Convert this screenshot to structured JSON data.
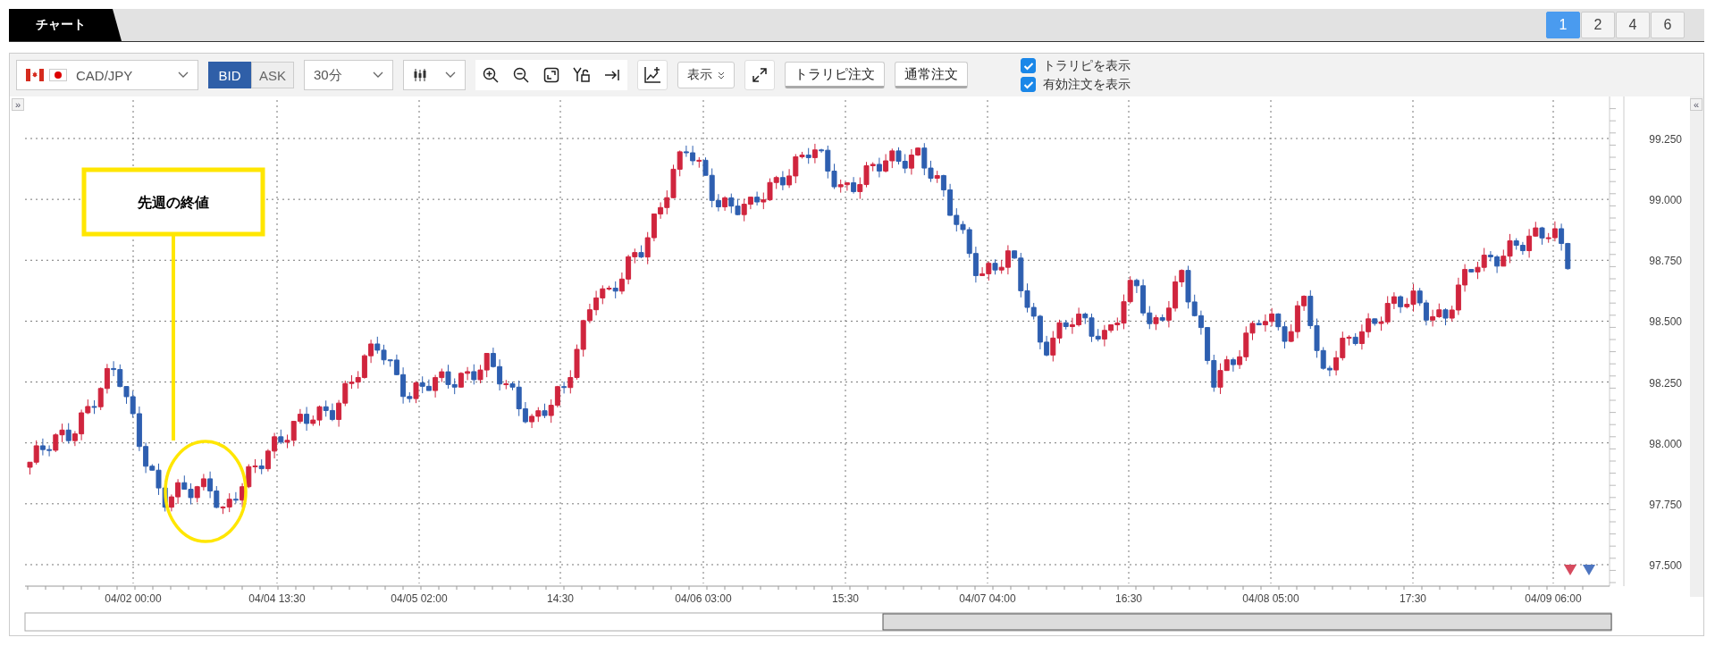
{
  "tabs": [
    {
      "label": "チャート",
      "selected": true
    }
  ],
  "layout_buttons": [
    {
      "label": "1",
      "selected": true
    },
    {
      "label": "2",
      "selected": false
    },
    {
      "label": "4",
      "selected": false
    },
    {
      "label": "6",
      "selected": false
    }
  ],
  "toolbar": {
    "pair": "CAD/JPY",
    "price_type": [
      {
        "label": "BID",
        "selected": true
      },
      {
        "label": "ASK",
        "selected": false
      }
    ],
    "timeframe": "30分",
    "display_button": "表示",
    "order_buttons": [
      "トラリピ注文",
      "通常注文"
    ],
    "checkboxes": [
      {
        "label": "トラリピを表示",
        "checked": true
      },
      {
        "label": "有効注文を表示",
        "checked": true
      }
    ]
  },
  "chart": {
    "left_toggle": "»",
    "right_toggle": "«",
    "annotation": "先週の終値",
    "y_labels": [
      "99.250",
      "99.000",
      "98.750",
      "98.500",
      "98.250",
      "98.000",
      "97.750",
      "97.500"
    ],
    "x_labels": [
      "04/02 00:00",
      "04/04 13:30",
      "04/05 02:00",
      "14:30",
      "04/06 03:00",
      "15:30",
      "04/07 04:00",
      "16:30",
      "04/08 05:00",
      "17:30",
      "04/09 06:00"
    ]
  }
}
